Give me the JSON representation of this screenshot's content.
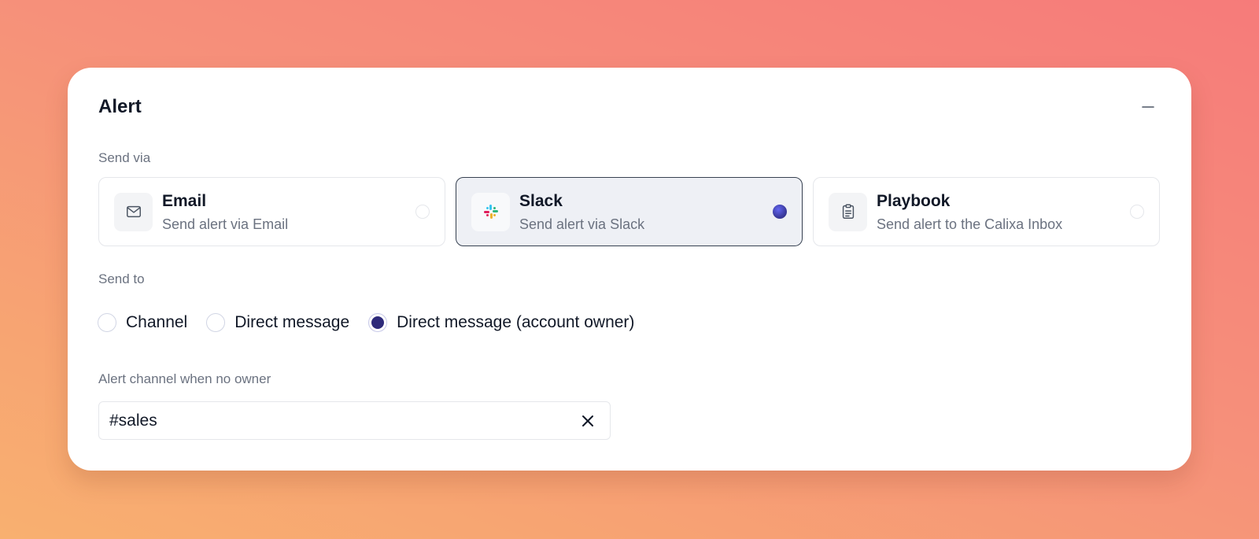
{
  "card": {
    "title": "Alert",
    "minimize_icon": "minus-icon"
  },
  "send_via": {
    "label": "Send via",
    "options": [
      {
        "title": "Email",
        "description": "Send alert via Email",
        "icon": "mail-icon",
        "selected": false
      },
      {
        "title": "Slack",
        "description": "Send alert via Slack",
        "icon": "slack-icon",
        "selected": true
      },
      {
        "title": "Playbook",
        "description": "Send alert to the Calixa Inbox",
        "icon": "clipboard-icon",
        "selected": false
      }
    ]
  },
  "send_to": {
    "label": "Send to",
    "options": [
      {
        "label": "Channel",
        "selected": false
      },
      {
        "label": "Direct message",
        "selected": false
      },
      {
        "label": "Direct message (account owner)",
        "selected": true
      }
    ]
  },
  "fallback_channel": {
    "label": "Alert channel when no owner",
    "value": "#sales",
    "clear_icon": "close-icon"
  },
  "colors": {
    "accent": "#2e2a7a",
    "selected_border": "#374151",
    "selected_bg": "#eef0f5"
  }
}
